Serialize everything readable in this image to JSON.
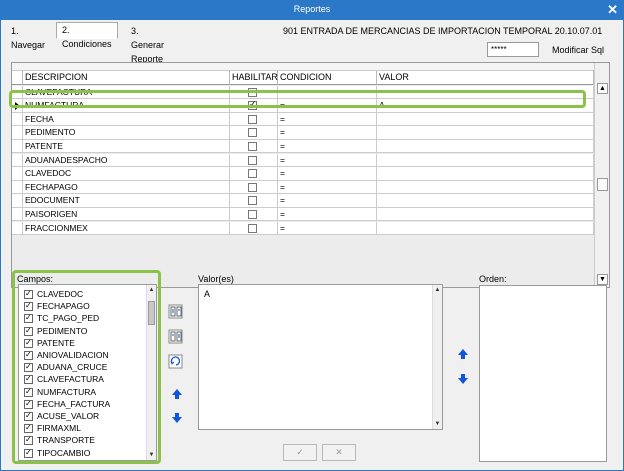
{
  "window": {
    "title": "Reportes",
    "close_glyph": "✕"
  },
  "tabs": [
    {
      "label": "1. Navegar"
    },
    {
      "label": "2. Condiciones"
    },
    {
      "label": "3. Generar Reporte"
    }
  ],
  "report_name": "901 ENTRADA DE MERCANCIAS DE IMPORTACION TEMPORAL 20.10.07.01",
  "sql": {
    "value": "*****",
    "button_label": "Modificar Sql"
  },
  "grid": {
    "columns": [
      "DESCRIPCION",
      "HABILITAR",
      "CONDICION",
      "VALOR"
    ],
    "rows": [
      {
        "desc": "CLAVEFACTURA",
        "enabled": false,
        "cond": "",
        "value": ""
      },
      {
        "desc": "NUMFACTURA",
        "enabled": true,
        "cond": "=",
        "value": "A"
      },
      {
        "desc": "FECHA",
        "enabled": false,
        "cond": "=",
        "value": ""
      },
      {
        "desc": "PEDIMENTO",
        "enabled": false,
        "cond": "=",
        "value": ""
      },
      {
        "desc": "PATENTE",
        "enabled": false,
        "cond": "=",
        "value": ""
      },
      {
        "desc": "ADUANADESPACHO",
        "enabled": false,
        "cond": "=",
        "value": ""
      },
      {
        "desc": "CLAVEDOC",
        "enabled": false,
        "cond": "=",
        "value": ""
      },
      {
        "desc": "FECHAPAGO",
        "enabled": false,
        "cond": "=",
        "value": ""
      },
      {
        "desc": "EDOCUMENT",
        "enabled": false,
        "cond": "=",
        "value": ""
      },
      {
        "desc": "PAISORIGEN",
        "enabled": false,
        "cond": "=",
        "value": ""
      },
      {
        "desc": "FRACCIONMEX",
        "enabled": false,
        "cond": "=",
        "value": ""
      }
    ]
  },
  "campos": {
    "label": "Campos:",
    "items": [
      "CLAVEDOC",
      "FECHAPAGO",
      "TC_PAGO_PED",
      "PEDIMENTO",
      "PATENTE",
      "ANIOVALIDACION",
      "ADUANA_CRUCE",
      "CLAVEFACTURA",
      "NUMFACTURA",
      "FECHA_FACTURA",
      "ACUSE_VALOR",
      "FIRMAXML",
      "TRANSPORTE",
      "TIPOCAMBIO"
    ]
  },
  "valores": {
    "label": "Valor(es)",
    "text": "A"
  },
  "orden": {
    "label": "Orden:"
  },
  "buttons": {
    "ok_glyph": "✓",
    "cancel_glyph": "✕"
  },
  "colors": {
    "titlebar": "#2b78c8",
    "highlight": "#8bc34a",
    "arrow_blue": "#1155dd"
  }
}
